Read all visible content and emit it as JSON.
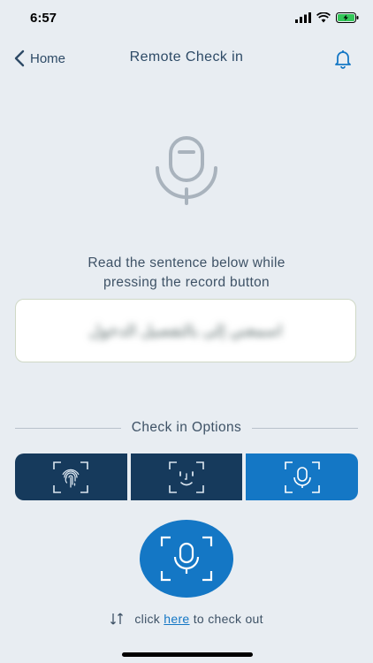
{
  "status": {
    "time": "6:57"
  },
  "nav": {
    "back_label": "Home",
    "title": "Remote Check in"
  },
  "instruction": {
    "line1": "Read the sentence below while",
    "line2": "pressing the record button"
  },
  "sentence": {
    "text": "اسمعني إلى بالتفصيل الدخول"
  },
  "options": {
    "heading": "Check in Options",
    "items": [
      {
        "icon": "fingerprint-scan-icon",
        "selected": false
      },
      {
        "icon": "face-scan-icon",
        "selected": false
      },
      {
        "icon": "voice-scan-icon",
        "selected": true
      }
    ]
  },
  "record": {
    "icon": "microphone-record-icon"
  },
  "checkout": {
    "prefix": "click",
    "link": "here",
    "suffix": "to check out"
  },
  "colors": {
    "primary": "#1477c5",
    "dark": "#163a5c",
    "background": "#e8edf2"
  }
}
